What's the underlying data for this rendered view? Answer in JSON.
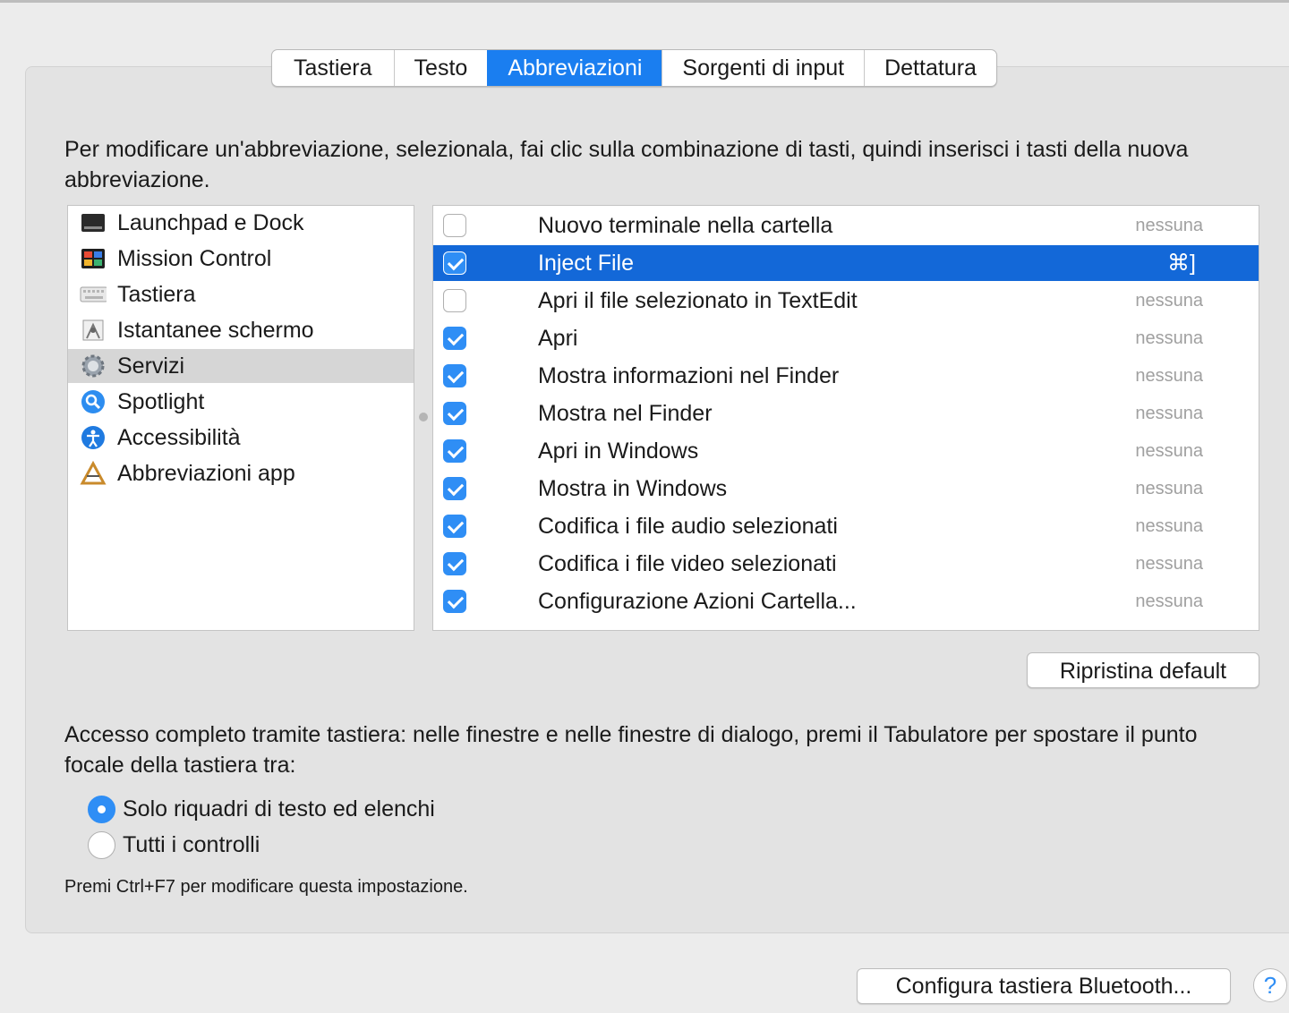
{
  "tabs": [
    "Tastiera",
    "Testo",
    "Abbreviazioni",
    "Sorgenti di input",
    "Dettatura"
  ],
  "active_tab": "Abbreviazioni",
  "description": "Per modificare un'abbreviazione, selezionala, fai clic sulla combinazione di tasti, quindi inserisci i tasti della nuova abbreviazione.",
  "categories": [
    {
      "label": "Launchpad e Dock",
      "icon": "launchpad-dock-icon"
    },
    {
      "label": "Mission Control",
      "icon": "mission-control-icon"
    },
    {
      "label": "Tastiera",
      "icon": "keyboard-icon"
    },
    {
      "label": "Istantanee schermo",
      "icon": "screenshot-icon"
    },
    {
      "label": "Servizi",
      "icon": "gear-icon",
      "selected": true
    },
    {
      "label": "Spotlight",
      "icon": "spotlight-icon"
    },
    {
      "label": "Accessibilità",
      "icon": "accessibility-icon"
    },
    {
      "label": "Abbreviazioni app",
      "icon": "app-shortcuts-icon"
    }
  ],
  "shortcuts": [
    {
      "label": "Nuovo terminale nella cartella",
      "key": "nessuna",
      "checked": false
    },
    {
      "label": "Inject File",
      "key": "⌘]",
      "checked": true,
      "selected": true
    },
    {
      "label": "Apri il file selezionato in TextEdit",
      "key": "nessuna",
      "checked": false
    },
    {
      "label": "Apri",
      "key": "nessuna",
      "checked": true
    },
    {
      "label": "Mostra informazioni nel Finder",
      "key": "nessuna",
      "checked": true
    },
    {
      "label": "Mostra nel Finder",
      "key": "nessuna",
      "checked": true
    },
    {
      "label": "Apri in Windows",
      "key": "nessuna",
      "checked": true
    },
    {
      "label": "Mostra in Windows",
      "key": "nessuna",
      "checked": true
    },
    {
      "label": "Codifica i file audio selezionati",
      "key": "nessuna",
      "checked": true
    },
    {
      "label": "Codifica i file video selezionati",
      "key": "nessuna",
      "checked": true
    },
    {
      "label": "Configurazione Azioni Cartella...",
      "key": "nessuna",
      "checked": true
    }
  ],
  "reset_button": "Ripristina default",
  "access_text": "Accesso completo tramite tastiera: nelle finestre e nelle finestre di dialogo, premi il Tabulatore per spostare il punto focale della tastiera tra:",
  "radio_options": [
    {
      "label": "Solo riquadri di testo ed elenchi",
      "checked": true
    },
    {
      "label": "Tutti i controlli",
      "checked": false
    }
  ],
  "hint": "Premi Ctrl+F7 per modificare questa impostazione.",
  "bluetooth_button": "Configura tastiera Bluetooth...",
  "help_button": "?",
  "colors": {
    "accent": "#1a7ef0",
    "selection": "#1368d8",
    "checkbox": "#2f8ef5"
  }
}
